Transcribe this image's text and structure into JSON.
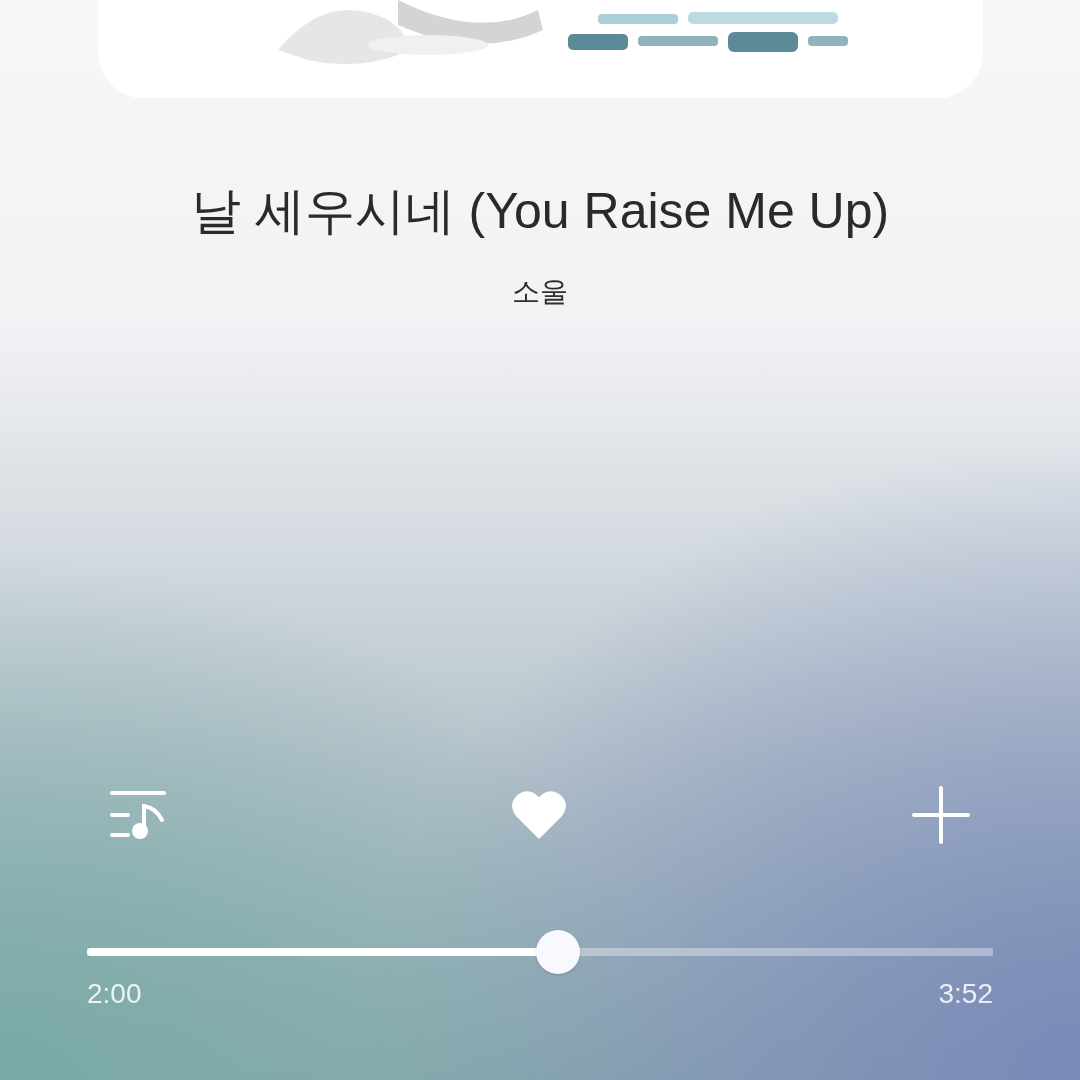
{
  "track": {
    "title": "날 세우시네 (You Raise Me Up)",
    "artist": "소울"
  },
  "actions": [
    {
      "kind": "playlist"
    },
    {
      "kind": "like",
      "on": true
    },
    {
      "kind": "add"
    }
  ],
  "progress": {
    "level": 0.52,
    "elapsed": "2:00",
    "total": "3:52"
  }
}
